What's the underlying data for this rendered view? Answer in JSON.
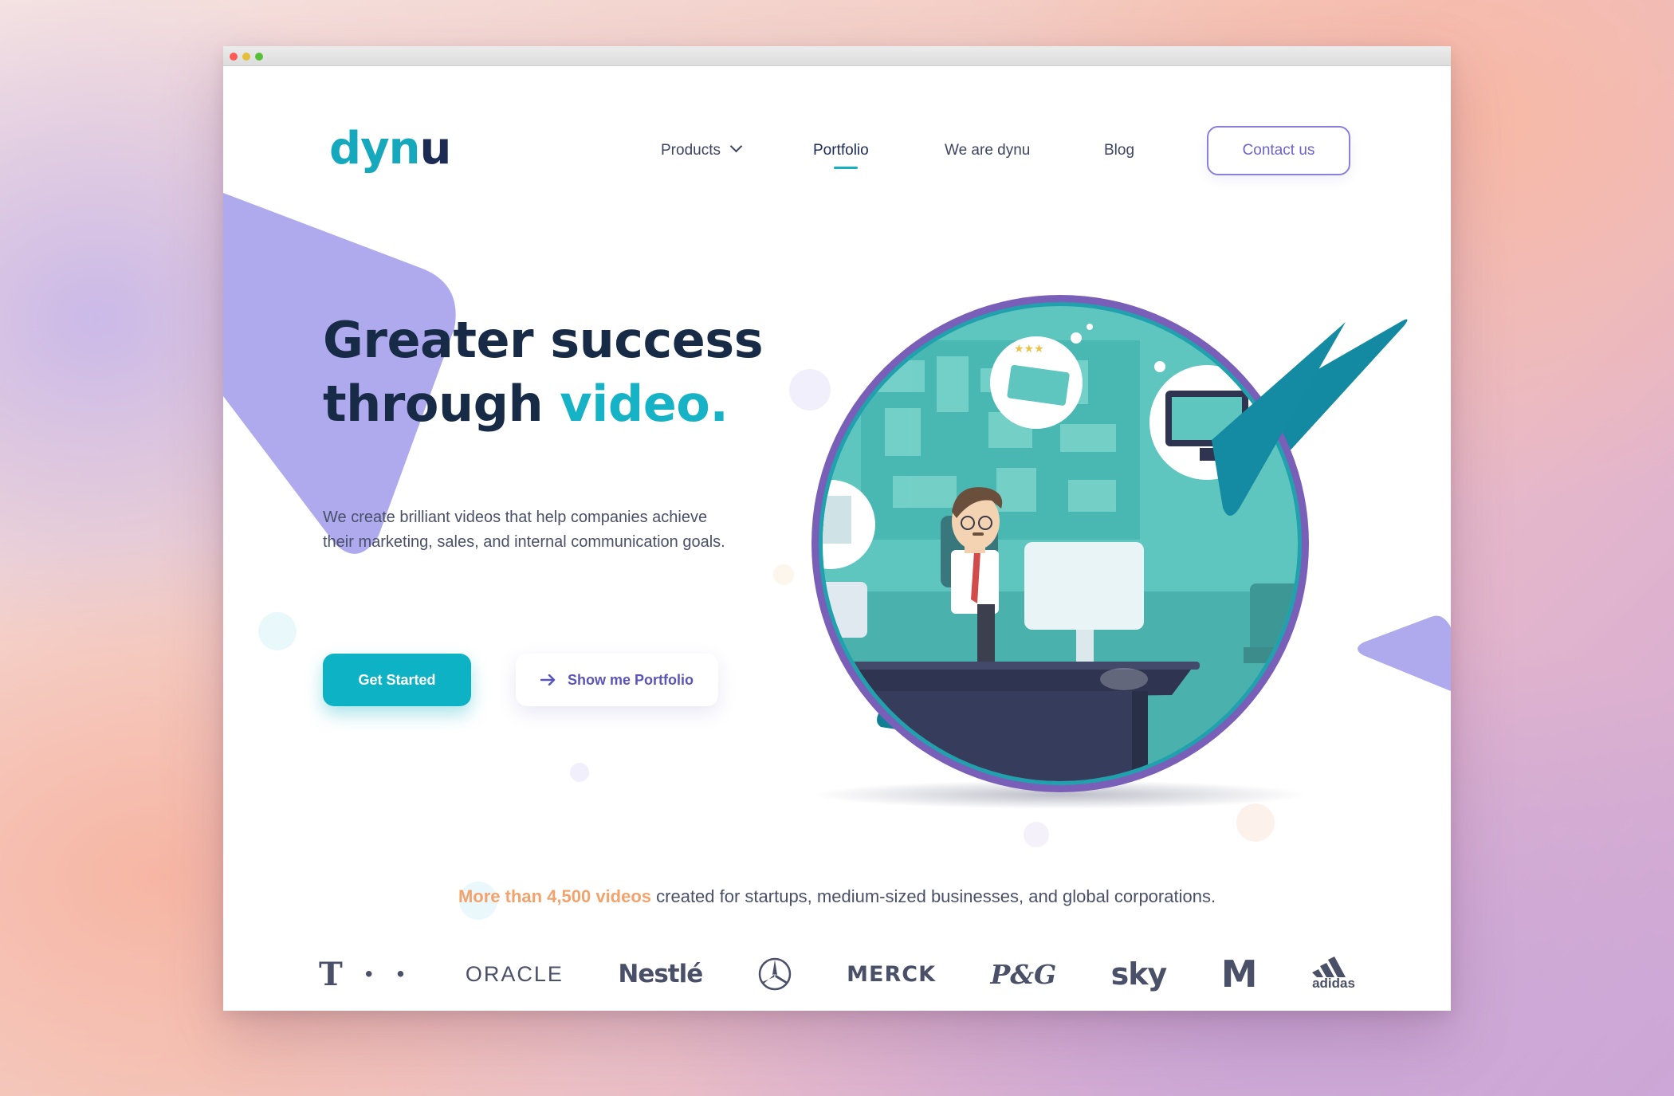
{
  "brand": {
    "logo_main": "dyn",
    "logo_tail": "u"
  },
  "nav": {
    "products": "Products",
    "portfolio": "Portfolio",
    "we_are": "We are dynu",
    "blog": "Blog",
    "contact": "Contact us",
    "active": "Portfolio"
  },
  "hero": {
    "headline_line1": "Greater success",
    "headline_line2_prefix": "through ",
    "headline_line2_accent": "video.",
    "subtext": "We create brilliant videos that help companies achieve their marketing, sales, and internal communication goals.",
    "primary_button": "Get Started",
    "secondary_button": "Show me Portfolio"
  },
  "clients": {
    "tagline_highlight": "More than 4,500 videos",
    "tagline_rest": " created for startups, medium-sized businesses, and global corporations.",
    "logos": {
      "telekom": "T · ·",
      "oracle": "ORACLE",
      "nestle": "Nestlé",
      "mercedes": "Mercedes-Benz",
      "merck": "MERCK",
      "pg": "P&G",
      "sky": "sky",
      "mcdonalds": "M",
      "adidas": "adidas"
    }
  },
  "colors": {
    "teal": "#0db3c4",
    "navy": "#172a46",
    "purple": "#6c63c9",
    "lavender": "#aba6ee",
    "orange_highlight": "#f2a36d"
  },
  "icons": {
    "products_chevron": "chevron-down-icon",
    "portfolio_arrow": "arrow-right-icon",
    "window_controls": [
      "close-dot",
      "minimize-dot",
      "maximize-dot"
    ]
  }
}
